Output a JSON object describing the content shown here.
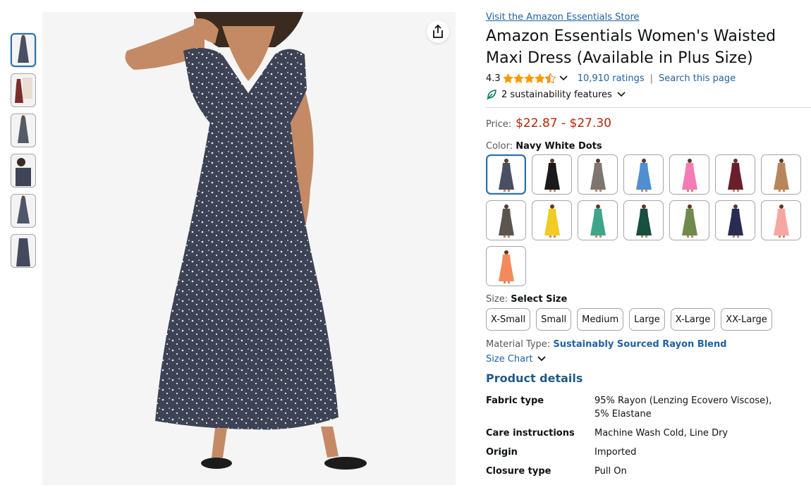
{
  "store_link": "Visit the Amazon Essentials Store",
  "title": "Amazon Essentials Women's Waisted Maxi Dress (Available in Plus Size)",
  "rating": {
    "value": "4.3",
    "stars": 4.3,
    "ratings_count": "10,910 ratings",
    "separator": "|",
    "search_link": "Search this page"
  },
  "sustainability": "2 sustainability features",
  "price": {
    "label": "Price:",
    "value": "$22.87 - $27.30"
  },
  "color": {
    "label": "Color:",
    "selected": "Navy White Dots",
    "swatch_colors": [
      "#4a5063",
      "#1a1a1a",
      "#7e7470",
      "#4f8ed0",
      "#f57bb7",
      "#6b1e2c",
      "#b8865a",
      "#5a5550",
      "#f2cc24",
      "#3fa58a",
      "#174f40",
      "#6f8a4c",
      "#272c52",
      "#f6a7a3",
      "#f28a5c"
    ]
  },
  "thumb_colors": [
    "#4a5063",
    "#7a2d2a",
    "#555a66",
    "#3f4458",
    "#50566a",
    "#444a5e"
  ],
  "size": {
    "label": "Size:",
    "selected": "Select Size",
    "options": [
      "X-Small",
      "Small",
      "Medium",
      "Large",
      "X-Large",
      "XX-Large"
    ]
  },
  "material": {
    "label": "Material Type:",
    "value": "Sustainably Sourced Rayon Blend"
  },
  "size_chart": "Size Chart",
  "product_details": {
    "heading": "Product details",
    "rows": [
      {
        "key": "Fabric type",
        "value": "95% Rayon (Lenzing Ecovero Viscose), 5% Elastane"
      },
      {
        "key": "Care instructions",
        "value": "Machine Wash Cold, Line Dry"
      },
      {
        "key": "Origin",
        "value": "Imported"
      },
      {
        "key": "Closure type",
        "value": "Pull On"
      }
    ]
  },
  "colors": {
    "link": "#2162a1",
    "price": "#b12704",
    "star": "#ff9900",
    "selected_border": "#2f6fa6",
    "dress_navy": "#3d4355"
  }
}
